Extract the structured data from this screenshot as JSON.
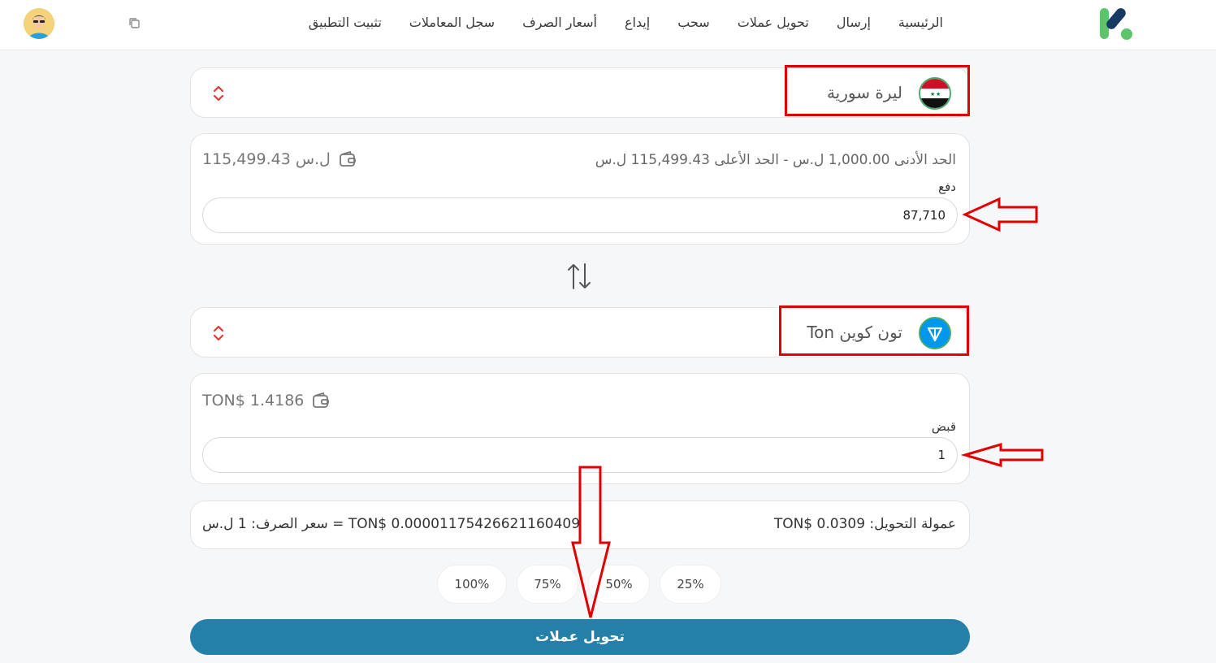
{
  "nav": {
    "items": [
      "الرئيسية",
      "إرسال",
      "تحويل عملات",
      "سحب",
      "إيداع",
      "أسعار الصرف",
      "سجل المعاملات",
      "تثبيت التطبيق"
    ]
  },
  "from_currency": {
    "label": "ليرة سورية",
    "flag_icon": "syria-flag-icon",
    "limits_text": "الحد الأدنى 1,000.00 ل.س   -   الحد الأعلى 115,499.43 ل.س",
    "balance": "115,499.43 ل.س",
    "field_label": "دفع",
    "value": "87,710"
  },
  "to_currency": {
    "label": "Ton تون كوين",
    "flag_icon": "ton-coin-icon",
    "balance": "TON$ 1.4186",
    "field_label": "قبض",
    "value": "1"
  },
  "info": {
    "fee": "عمولة التحويل: TON$ 0.0309",
    "rate": "سعر الصرف: 1 ل.س = TON$ 0.00001175426621160409"
  },
  "percent_buttons": [
    "25%",
    "50%",
    "75%",
    "100%"
  ],
  "submit_label": "تحويل عملات",
  "colors": {
    "accent": "#2480a8",
    "annotation_red": "#e00000",
    "chevron_red": "#e53935"
  }
}
